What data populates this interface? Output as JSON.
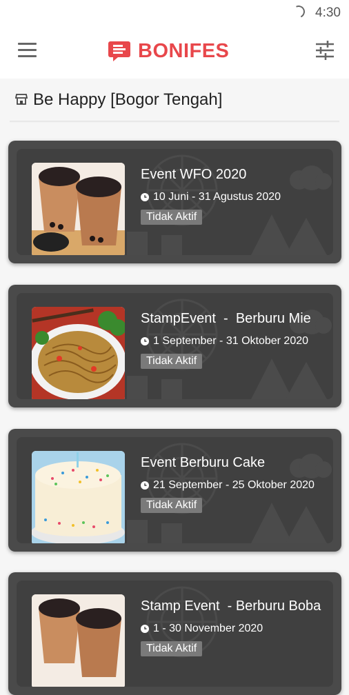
{
  "status_bar": {
    "time": "4:30"
  },
  "app_bar": {
    "logo_text": "BONIFES",
    "menu_icon": "hamburger-icon",
    "filter_icon": "sliders-icon"
  },
  "store": {
    "name": "Be Happy [Bogor Tengah]",
    "icon": "store-icon"
  },
  "colors": {
    "brand": "#e8474b",
    "card_bg": "#4a4a4a",
    "badge_bg": "#7a7a7a"
  },
  "events": [
    {
      "title": "Event WFO 2020",
      "date": "10 Juni - 31 Agustus 2020",
      "status": "Tidak Aktif",
      "image": "boba-drinks"
    },
    {
      "title": "StampEvent  -  Berburu Mie",
      "date": "1 September - 31 Oktober 2020",
      "status": "Tidak Aktif",
      "image": "fried-noodles"
    },
    {
      "title": "Event Berburu Cake",
      "date": "21 September - 25 Oktober 2020",
      "status": "Tidak Aktif",
      "image": "sprinkle-cake"
    },
    {
      "title": "Stamp Event  - Berburu Boba",
      "date": "1 - 30 November 2020",
      "status": "Tidak Aktif",
      "image": "boba-drinks"
    }
  ]
}
